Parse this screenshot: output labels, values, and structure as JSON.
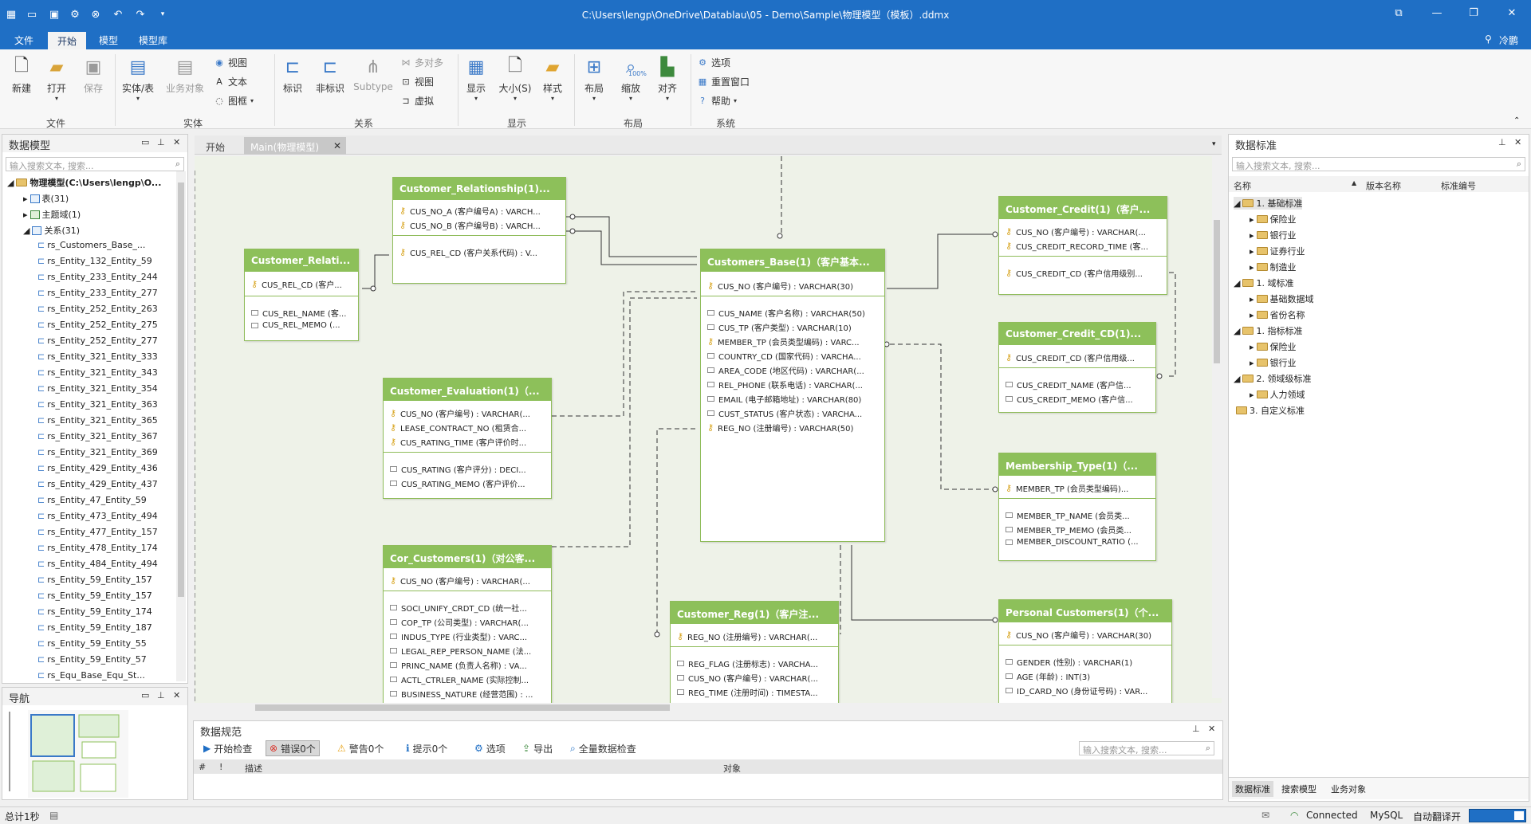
{
  "titlebar": {
    "title": "C:\\Users\\lengp\\OneDrive\\Datablau\\05 - Demo\\Sample\\物理模型（模板）.ddmx"
  },
  "menu": {
    "file": "文件",
    "start": "开始",
    "model": "模型",
    "library": "模型库",
    "user": "冷鹏"
  },
  "ribbon": {
    "new": "新建",
    "open": "打开",
    "save": "保存",
    "entity_table": "实体/表",
    "business_object": "业务对象",
    "view": "视图",
    "text": "文本",
    "frame": "图框",
    "identify": "标识",
    "non_identify": "非标识",
    "subtype": "Subtype",
    "many_to_many": "多对多",
    "view2": "视图",
    "virtual": "虚拟",
    "display": "显示",
    "size": "大小(S)",
    "style": "样式",
    "layout": "布局",
    "zoom": "缩放",
    "zoom_pct": "100%",
    "align": "对齐",
    "options": "选项",
    "reset_window": "重置窗口",
    "help": "帮助",
    "group_file": "文件",
    "group_entity": "实体",
    "group_relation": "关系",
    "group_display": "显示",
    "group_layout": "布局",
    "group_system": "系统"
  },
  "left_panel": {
    "title": "数据模型",
    "search_placeholder": "输入搜索文本, 搜索...",
    "root": "物理模型(C:\\Users\\lengp\\O...",
    "tables": "表(31)",
    "themes": "主题域(1)",
    "relations": "关系(31)",
    "items": [
      "rs_Customers_Base_...",
      "rs_Entity_132_Entity_59",
      "rs_Entity_233_Entity_244",
      "rs_Entity_233_Entity_277",
      "rs_Entity_252_Entity_263",
      "rs_Entity_252_Entity_275",
      "rs_Entity_252_Entity_277",
      "rs_Entity_321_Entity_333",
      "rs_Entity_321_Entity_343",
      "rs_Entity_321_Entity_354",
      "rs_Entity_321_Entity_363",
      "rs_Entity_321_Entity_365",
      "rs_Entity_321_Entity_367",
      "rs_Entity_321_Entity_369",
      "rs_Entity_429_Entity_436",
      "rs_Entity_429_Entity_437",
      "rs_Entity_47_Entity_59",
      "rs_Entity_473_Entity_494",
      "rs_Entity_477_Entity_157",
      "rs_Entity_478_Entity_174",
      "rs_Entity_484_Entity_494",
      "rs_Entity_59_Entity_157",
      "rs_Entity_59_Entity_157",
      "rs_Entity_59_Entity_174",
      "rs_Entity_59_Entity_187",
      "rs_Entity_59_Entity_55",
      "rs_Entity_59_Entity_57",
      "rs_Equ_Base_Equ_St..."
    ]
  },
  "nav_panel": {
    "title": "导航"
  },
  "tabs": {
    "start": "开始",
    "main": "Main(物理模型)"
  },
  "entities": {
    "cust_rel": {
      "title": "Customer_Relationship(1)...",
      "rows": [
        "CUS_NO_A (客户编号A) : VARCH...",
        "CUS_NO_B (客户编号B) : VARCH...",
        "CUS_REL_CD (客户关系代码) : V..."
      ]
    },
    "cust_relati": {
      "title": "Customer_Relati...",
      "rows": [
        "CUS_REL_CD (客户...",
        "CUS_REL_NAME (客...",
        "CUS_REL_MEMO (..."
      ]
    },
    "cust_base": {
      "title": "Customers_Base(1)（客户基本...",
      "rows": [
        "CUS_NO (客户编号) : VARCHAR(30)",
        "CUS_NAME (客户名称) : VARCHAR(50)",
        "CUS_TP (客户类型) : VARCHAR(10)",
        "MEMBER_TP (会员类型编码) : VARC...",
        "COUNTRY_CD (国家代码) : VARCHA...",
        "AREA_CODE (地区代码) : VARCHAR(...",
        "REL_PHONE (联系电话) : VARCHAR(...",
        "EMAIL (电子邮箱地址) : VARCHAR(80)",
        "CUST_STATUS (客户状态) : VARCHA...",
        "REG_NO (注册编号) : VARCHAR(50)"
      ]
    },
    "cust_eval": {
      "title": "Customer_Evaluation(1)（...",
      "rows": [
        "CUS_NO (客户编号) : VARCHAR(...",
        "LEASE_CONTRACT_NO (租赁合...",
        "CUS_RATING_TIME (客户评价时...",
        "CUS_RATING (客户评分) : DECI...",
        "CUS_RATING_MEMO (客户评价..."
      ]
    },
    "cor_cust": {
      "title": "Cor_Customers(1)（对公客...",
      "rows": [
        "CUS_NO (客户编号) : VARCHAR(...",
        "SOCI_UNIFY_CRDT_CD (统一社...",
        "COP_TP (公司类型) : VARCHAR(...",
        "INDUS_TYPE (行业类型) : VARC...",
        "LEGAL_REP_PERSON_NAME (法...",
        "PRINC_NAME (负责人名称) : VA...",
        "ACTL_CTRLER_NAME (实际控制...",
        "BUSINESS_NATURE (经营范围) : ..."
      ]
    },
    "cust_reg": {
      "title": "Customer_Reg(1)（客户注...",
      "rows": [
        "REG_NO (注册编号) : VARCHAR(...",
        "REG_FLAG (注册标志) : VARCHA...",
        "CUS_NO (客户编号) : VARCHAR(...",
        "REG_TIME (注册时间) : TIMESTA..."
      ]
    },
    "cust_credit": {
      "title": "Customer_Credit(1)（客户...",
      "rows": [
        "CUS_NO (客户编号) : VARCHAR(...",
        "CUS_CREDIT_RECORD_TIME (客...",
        "CUS_CREDIT_CD (客户信用级别..."
      ]
    },
    "cust_credit_cd": {
      "title": "Customer_Credit_CD(1)...",
      "rows": [
        "CUS_CREDIT_CD (客户信用级...",
        "CUS_CREDIT_NAME (客户信...",
        "CUS_CREDIT_MEMO (客户信..."
      ]
    },
    "member_type": {
      "title": "Membership_Type(1)（...",
      "rows": [
        "MEMBER_TP (会员类型编码)...",
        "MEMBER_TP_NAME (会员类...",
        "MEMBER_TP_MEMO (会员类...",
        "MEMBER_DISCOUNT_RATIO (..."
      ]
    },
    "personal_cust": {
      "title": "Personal Customers(1)（个...",
      "rows": [
        "CUS_NO (客户编号) : VARCHAR(30)",
        "GENDER (性别) : VARCHAR(1)",
        "AGE (年龄) : INT(3)",
        "ID_CARD_NO (身份证号码) : VAR..."
      ]
    }
  },
  "check_panel": {
    "title": "数据规范",
    "start_check": "开始检查",
    "errors": "错误0个",
    "warnings": "警告0个",
    "hints": "提示0个",
    "options": "选项",
    "export": "导出",
    "full_check": "全量数据检查",
    "search_placeholder": "输入搜索文本, 搜索...",
    "col_num": "#",
    "col_flag": "!",
    "col_desc": "描述",
    "col_obj": "对象"
  },
  "right_panel": {
    "title": "数据标准",
    "search_placeholder": "输入搜索文本, 搜索...",
    "col_name": "名称",
    "col_version": "版本名称",
    "col_code": "标准编号",
    "items": [
      {
        "label": "1. 基础标准",
        "level": 0,
        "open": true
      },
      {
        "label": "保险业",
        "level": 1
      },
      {
        "label": "银行业",
        "level": 1
      },
      {
        "label": "证券行业",
        "level": 1
      },
      {
        "label": "制造业",
        "level": 1
      },
      {
        "label": "1. 域标准",
        "level": 0,
        "open": true
      },
      {
        "label": "基础数据域",
        "level": 1
      },
      {
        "label": "省份名称",
        "level": 1
      },
      {
        "label": "1. 指标标准",
        "level": 0,
        "open": true
      },
      {
        "label": "保险业",
        "level": 1
      },
      {
        "label": "银行业",
        "level": 1
      },
      {
        "label": "2. 领域级标准",
        "level": 0,
        "open": true
      },
      {
        "label": "人力领域",
        "level": 1
      },
      {
        "label": "3. 自定义标准",
        "level": 0,
        "open": false
      }
    ],
    "tabs": [
      "数据标准",
      "搜索模型",
      "业务对象"
    ]
  },
  "status": {
    "total": "总计1秒",
    "connected": "Connected",
    "db": "MySQL",
    "auto": "自动翻译开"
  }
}
